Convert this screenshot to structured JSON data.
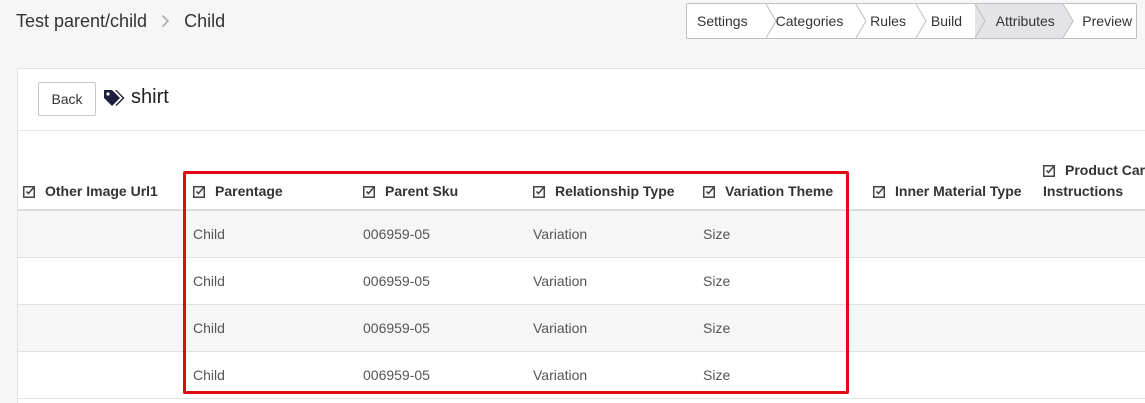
{
  "breadcrumb": {
    "parent": "Test parent/child",
    "current": "Child"
  },
  "steps": [
    {
      "label": "Settings",
      "active": false
    },
    {
      "label": "Categories",
      "active": false
    },
    {
      "label": "Rules",
      "active": false
    },
    {
      "label": "Build",
      "active": false
    },
    {
      "label": "Attributes",
      "active": true
    },
    {
      "label": "Preview",
      "active": false
    }
  ],
  "card": {
    "back_label": "Back",
    "title": "shirt"
  },
  "table": {
    "columns": [
      {
        "label": "Other Image Url1"
      },
      {
        "label": "Parentage"
      },
      {
        "label": "Parent Sku"
      },
      {
        "label": "Relationship Type"
      },
      {
        "label": "Variation Theme"
      },
      {
        "label": "Inner Material Type"
      },
      {
        "label": "Product Car",
        "label2": "Instructions"
      }
    ],
    "rows": [
      [
        "",
        "Child",
        "006959-05",
        "Variation",
        "Size",
        "",
        ""
      ],
      [
        "",
        "Child",
        "006959-05",
        "Variation",
        "Size",
        "",
        ""
      ],
      [
        "",
        "Child",
        "006959-05",
        "Variation",
        "Size",
        "",
        ""
      ],
      [
        "",
        "Child",
        "006959-05",
        "Variation",
        "Size",
        "",
        ""
      ]
    ]
  },
  "colors": {
    "highlight": "#e30613",
    "active_step": "#e4e4e8"
  }
}
